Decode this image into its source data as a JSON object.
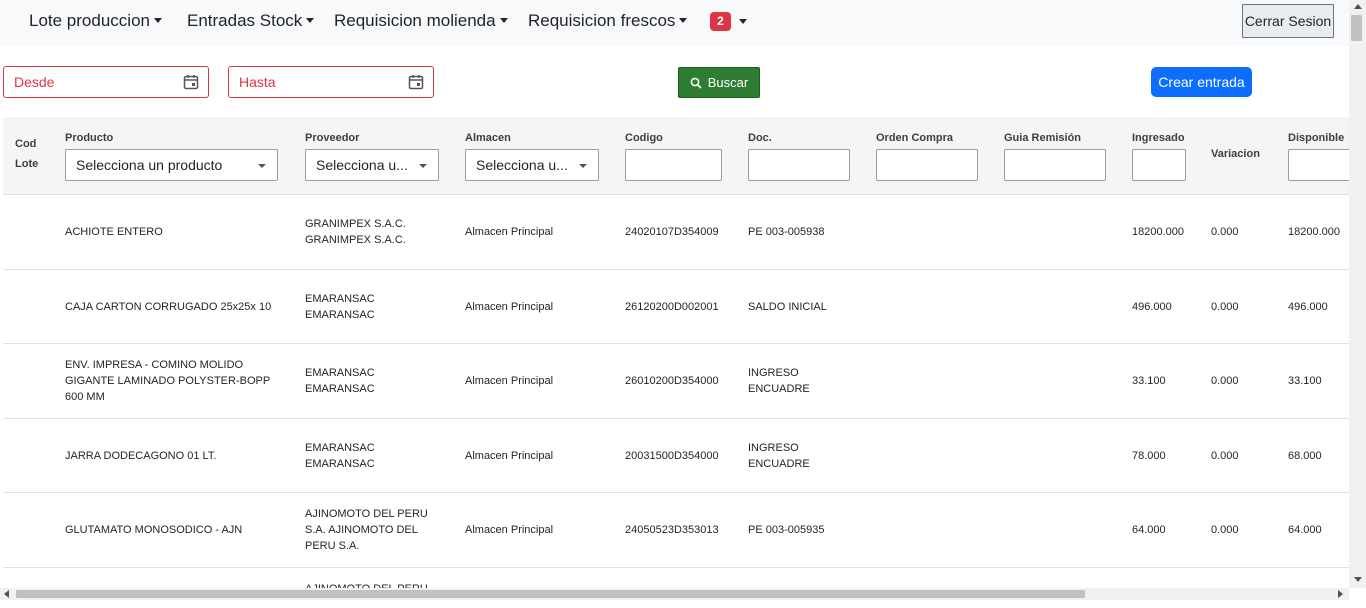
{
  "navbar": {
    "items": [
      {
        "label": "Lote produccion"
      },
      {
        "label": "Entradas Stock"
      },
      {
        "label": "Requisicion molienda"
      },
      {
        "label": "Requisicion frescos"
      }
    ],
    "notification_count": "2",
    "logout_label": "Cerrar Sesion"
  },
  "filters": {
    "from_placeholder": "Desde",
    "to_placeholder": "Hasta",
    "search_label": "Buscar",
    "create_label": "Crear entrada"
  },
  "table": {
    "headers": {
      "cod_lote_1": "Cod",
      "cod_lote_2": "Lote",
      "producto": "Producto",
      "proveedor": "Proveedor",
      "almacen": "Almacen",
      "codigo": "Codigo",
      "doc": "Doc.",
      "orden_compra": "Orden Compra",
      "guia_remision": "Guia Remisión",
      "ingresado": "Ingresado",
      "variacion": "Variacion",
      "disponible": "Disponible"
    },
    "filters": {
      "producto": "Selecciona un producto",
      "proveedor": "Selecciona u...",
      "almacen": "Selecciona u..."
    },
    "rows": [
      {
        "producto": "ACHIOTE ENTERO",
        "proveedor": "GRANIMPEX S.A.C. GRANIMPEX S.A.C.",
        "almacen": "Almacen Principal",
        "codigo": "24020107D354009",
        "doc": "PE 003-005938",
        "ingresado": "18200.000",
        "variacion": "0.000",
        "disponible": "18200.000"
      },
      {
        "producto": "CAJA CARTON CORRUGADO 25x25x 10",
        "proveedor": "EMARANSAC EMARANSAC",
        "almacen": "Almacen Principal",
        "codigo": "26120200D002001",
        "doc": "SALDO INICIAL",
        "ingresado": "496.000",
        "variacion": "0.000",
        "disponible": "496.000"
      },
      {
        "producto": "ENV. IMPRESA - COMINO MOLIDO GIGANTE LAMINADO POLYSTER-BOPP 600 MM",
        "proveedor": "EMARANSAC EMARANSAC",
        "almacen": "Almacen Principal",
        "codigo": "26010200D354000",
        "doc": "INGRESO ENCUADRE",
        "ingresado": "33.100",
        "variacion": "0.000",
        "disponible": "33.100"
      },
      {
        "producto": "JARRA DODECAGONO 01 LT.",
        "proveedor": "EMARANSAC EMARANSAC",
        "almacen": "Almacen Principal",
        "codigo": "20031500D354000",
        "doc": "INGRESO ENCUADRE",
        "ingresado": "78.000",
        "variacion": "0.000",
        "disponible": "68.000"
      },
      {
        "producto": "GLUTAMATO MONOSODICO - AJN",
        "proveedor": "AJINOMOTO DEL PERU S.A. AJINOMOTO DEL PERU S.A.",
        "almacen": "Almacen Principal",
        "codigo": "24050523D353013",
        "doc": "PE 003-005935",
        "ingresado": "64.000",
        "variacion": "0.000",
        "disponible": "64.000"
      },
      {
        "producto": "",
        "proveedor": "AJINOMOTO DEL PERU",
        "almacen": "",
        "codigo": "",
        "doc": "",
        "ingresado": "",
        "variacion": "",
        "disponible": ""
      }
    ]
  }
}
